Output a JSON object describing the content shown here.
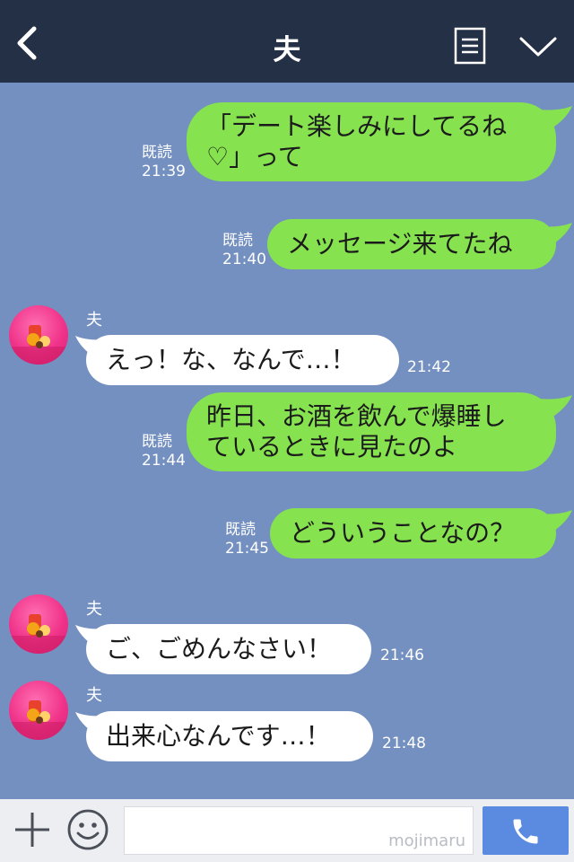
{
  "header": {
    "title": "夫",
    "back_icon": "chevron-left-icon",
    "notes_icon": "note-list-icon",
    "menu_icon": "chevron-down-icon"
  },
  "colors": {
    "header_bg": "#243045",
    "chat_bg": "#7390c1",
    "outgoing_bubble": "#86e34f",
    "incoming_bubble": "#ffffff",
    "send_button": "#5b8be0"
  },
  "messages": [
    {
      "direction": "out",
      "lines": [
        "「デート楽しみにしてるね",
        "♡」って"
      ],
      "read": "既読",
      "time": "21:39"
    },
    {
      "direction": "out",
      "lines": [
        "メッセージ来てたね"
      ],
      "read": "既読",
      "time": "21:40"
    },
    {
      "direction": "in",
      "sender": "夫",
      "lines": [
        "えっ！な、なんで…！"
      ],
      "time": "21:42"
    },
    {
      "direction": "out",
      "lines": [
        "昨日、お酒を飲んで爆睡し",
        "ているときに見たのよ"
      ],
      "read": "既読",
      "time": "21:44"
    },
    {
      "direction": "out",
      "lines": [
        "どういうことなの？"
      ],
      "read": "既読",
      "time": "21:45"
    },
    {
      "direction": "in",
      "sender": "夫",
      "lines": [
        "ご、ごめんなさい！"
      ],
      "time": "21:46"
    },
    {
      "direction": "in",
      "sender": "夫",
      "lines": [
        "出来心なんです…！"
      ],
      "time": "21:48"
    }
  ],
  "input_bar": {
    "plus_icon": "plus-icon",
    "sticker_icon": "smiley-icon",
    "text": "",
    "watermark": "mojimaru",
    "call_icon": "phone-icon"
  }
}
